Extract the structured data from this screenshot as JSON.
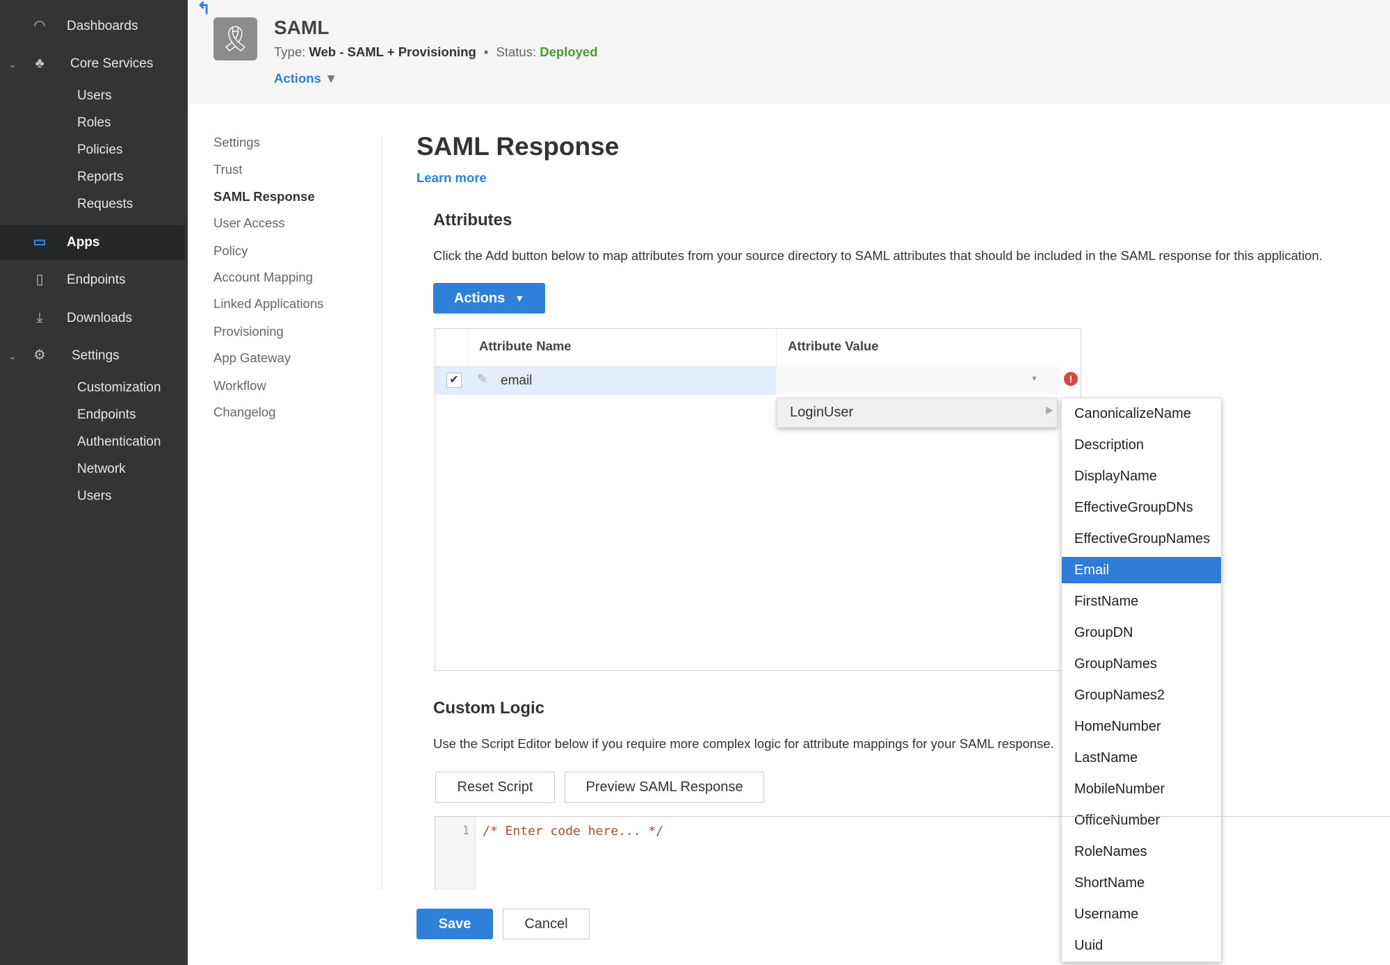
{
  "sidebar": {
    "items": [
      {
        "label": "Dashboards",
        "icon": "gauge-icon"
      },
      {
        "label": "Core Services",
        "icon": "core-services-icon",
        "expanded": true,
        "children": [
          "Users",
          "Roles",
          "Policies",
          "Reports",
          "Requests"
        ]
      },
      {
        "label": "Apps",
        "icon": "apps-icon",
        "active": true
      },
      {
        "label": "Endpoints",
        "icon": "mobile-icon"
      },
      {
        "label": "Downloads",
        "icon": "download-icon"
      },
      {
        "label": "Settings",
        "icon": "gear-icon",
        "expanded": true,
        "children": [
          "Customization",
          "Endpoints",
          "Authentication",
          "Network",
          "Users"
        ]
      }
    ]
  },
  "header": {
    "title": "SAML",
    "type_label": "Type:",
    "type_value": "Web - SAML + Provisioning",
    "status_label": "Status:",
    "status_value": "Deployed",
    "actions": "Actions",
    "status_color": "#4a9a2e"
  },
  "subnav": [
    "Settings",
    "Trust",
    "SAML Response",
    "User Access",
    "Policy",
    "Account Mapping",
    "Linked Applications",
    "Provisioning",
    "App Gateway",
    "Workflow",
    "Changelog"
  ],
  "main": {
    "title": "SAML Response",
    "learn_more": "Learn more",
    "attributes": {
      "heading": "Attributes",
      "description": "Click the Add button below to map attributes from your source directory to SAML attributes that should be included in the SAML response for this application.",
      "actions": "Actions",
      "columns": [
        "Attribute Name",
        "Attribute Value"
      ],
      "rows": [
        {
          "name": "email",
          "value": "",
          "checked": true
        }
      ]
    },
    "menu": {
      "item": "LoginUser",
      "submenu": [
        "CanonicalizeName",
        "Description",
        "DisplayName",
        "EffectiveGroupDNs",
        "EffectiveGroupNames",
        "Email",
        "FirstName",
        "GroupDN",
        "GroupNames",
        "GroupNames2",
        "HomeNumber",
        "LastName",
        "MobileNumber",
        "OfficeNumber",
        "RoleNames",
        "ShortName",
        "Username",
        "Uuid"
      ],
      "selected": "Email"
    },
    "custom_logic": {
      "heading": "Custom Logic",
      "description": "Use the Script Editor below if you require more complex logic for attribute mappings for your SAML response.",
      "reset": "Reset Script",
      "preview": "Preview SAML Response",
      "line_number": "1",
      "code": "/* Enter code here... */"
    },
    "save": "Save",
    "cancel": "Cancel"
  },
  "colors": {
    "accent": "#2f80d9",
    "sidebar": "#333436",
    "error": "#d9453a"
  }
}
